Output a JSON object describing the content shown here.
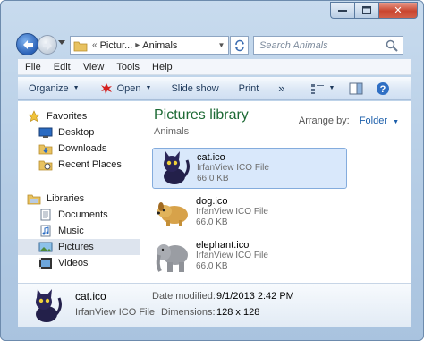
{
  "titlebar": {
    "close_glyph": "✕"
  },
  "address": {
    "breadcrumb": [
      "Pictur...",
      "Animals"
    ],
    "overflow": "«"
  },
  "search": {
    "placeholder": "Search Animals"
  },
  "menu": [
    "File",
    "Edit",
    "View",
    "Tools",
    "Help"
  ],
  "commands": {
    "organize": "Organize",
    "open": "Open",
    "slideshow": "Slide show",
    "print": "Print",
    "more": "»"
  },
  "sidebar": {
    "favorites": {
      "header": "Favorites",
      "items": [
        {
          "label": "Desktop",
          "icon": "desktop-icon"
        },
        {
          "label": "Downloads",
          "icon": "downloads-icon"
        },
        {
          "label": "Recent Places",
          "icon": "recent-places-icon"
        }
      ]
    },
    "libraries": {
      "header": "Libraries",
      "items": [
        {
          "label": "Documents",
          "icon": "documents-icon"
        },
        {
          "label": "Music",
          "icon": "music-icon"
        },
        {
          "label": "Pictures",
          "icon": "pictures-icon",
          "selected": true
        },
        {
          "label": "Videos",
          "icon": "videos-icon"
        }
      ]
    }
  },
  "library": {
    "title": "Pictures library",
    "subtitle": "Animals",
    "arrange_label": "Arrange by:",
    "arrange_value": "Folder"
  },
  "files": [
    {
      "name": "cat.ico",
      "type": "IrfanView ICO File",
      "size": "66.0 KB",
      "icon": "cat-icon",
      "selected": true
    },
    {
      "name": "dog.ico",
      "type": "IrfanView ICO File",
      "size": "66.0 KB",
      "icon": "dog-icon"
    },
    {
      "name": "elephant.ico",
      "type": "IrfanView ICO File",
      "size": "66.0 KB",
      "icon": "elephant-icon"
    }
  ],
  "details": {
    "name": "cat.ico",
    "type": "IrfanView ICO File",
    "date_label": "Date modified:",
    "date_value": "9/1/2013 2:42 PM",
    "dim_label": "Dimensions:",
    "dim_value": "128 x 128"
  },
  "colors": {
    "library_title": "#1d6a35",
    "selection": "#d9e8fb",
    "link_blue": "#1b5eaa"
  }
}
